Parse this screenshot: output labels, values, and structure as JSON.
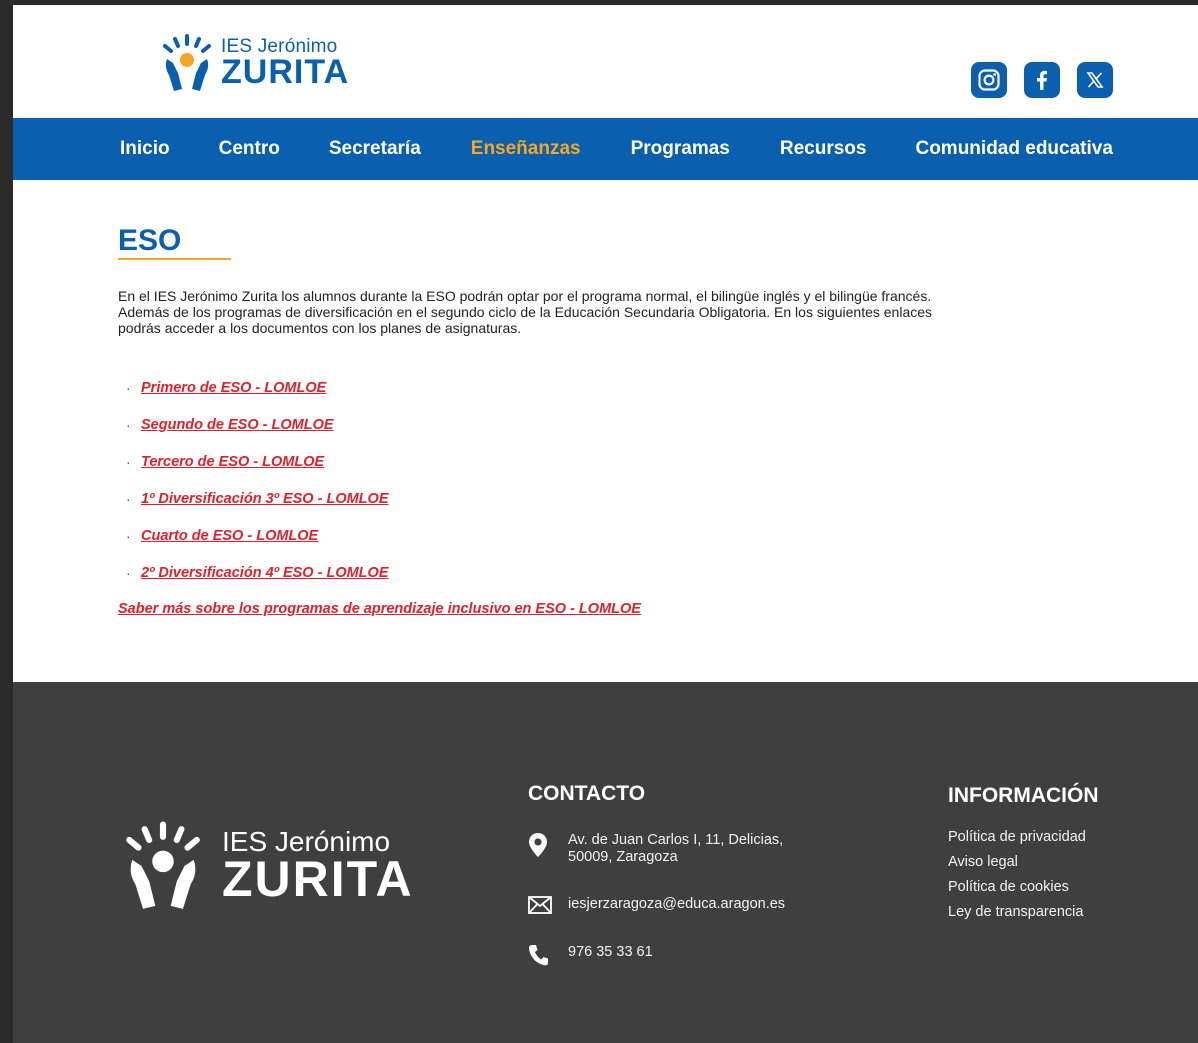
{
  "header": {
    "logo": {
      "small": "IES Jerónimo",
      "big": "ZURITA"
    },
    "social": [
      "instagram-icon",
      "facebook-icon",
      "x-icon"
    ]
  },
  "nav": {
    "items": [
      {
        "label": "Inicio"
      },
      {
        "label": "Centro"
      },
      {
        "label": "Secretaría"
      },
      {
        "label": "Enseñanzas"
      },
      {
        "label": "Programas"
      },
      {
        "label": "Recursos"
      },
      {
        "label": "Comunidad educativa"
      }
    ],
    "active": "Enseñanzas"
  },
  "main": {
    "title": "ESO",
    "intro": "En el IES Jerónimo Zurita los alumnos durante la ESO podrán optar por el programa normal, el bilingüe inglés y el bilingüe francés. Además de los programas de diversificación en el segundo ciclo de la Educación Secundaria Obligatoria. En los siguientes enlaces podrás acceder a los documentos con los planes de asignaturas.",
    "links": [
      "Primero de ESO - LOMLOE",
      "Segundo de ESO - LOMLOE",
      "Tercero de ESO - LOMLOE",
      "1º Diversificación 3º ESO - LOMLOE",
      "Cuarto de ESO - LOMLOE",
      "2º Diversificación 4º ESO - LOMLOE"
    ],
    "more_link": "Saber más sobre los programas de aprendizaje inclusivo en ESO - LOMLOE"
  },
  "footer": {
    "logo": {
      "small": "IES Jerónimo",
      "big": "ZURITA"
    },
    "contact": {
      "title": "CONTACTO",
      "address_line1": "Av. de Juan Carlos I, 11, Delicias,",
      "address_line2": "50009, Zaragoza",
      "email": "iesjerzaragoza@educa.aragon.es",
      "phone": "976 35 33 61"
    },
    "info": {
      "title": "INFORMACIÓN",
      "items": [
        "Política de privacidad",
        "Aviso legal",
        "Política de cookies",
        "Ley de transparencia"
      ]
    }
  },
  "colors": {
    "primary": "#0a5fae",
    "accent": "#f5a623",
    "link": "#e0212b",
    "footer": "#3f3f3f"
  }
}
